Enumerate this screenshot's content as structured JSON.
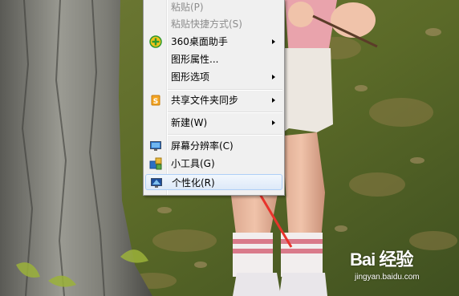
{
  "context_menu": {
    "items": [
      {
        "label": "粘贴(P)",
        "disabled": true
      },
      {
        "label": "粘贴快捷方式(S)",
        "disabled": true
      },
      {
        "label": "360桌面助手",
        "icon": "360-plus-icon",
        "submenu": true
      },
      {
        "label": "图形属性...",
        "disabled": false
      },
      {
        "label": "图形选项",
        "submenu": true
      },
      {
        "label": "共享文件夹同步",
        "icon": "sync-folder-icon",
        "submenu": true
      },
      {
        "label": "新建(W)",
        "submenu": true
      },
      {
        "label": "屏幕分辨率(C)",
        "icon": "monitor-icon"
      },
      {
        "label": "小工具(G)",
        "icon": "gadgets-icon"
      },
      {
        "label": "个性化(R)",
        "icon": "personalize-monitor-icon",
        "highlighted": true
      }
    ]
  },
  "watermark": {
    "logo": "Bai 经验",
    "url": "jingyan.baidu.com"
  },
  "colors": {
    "menu_bg": "#f0f0f0",
    "highlight_border": "#aecff7",
    "arrow_annotation": "#e8332b"
  }
}
